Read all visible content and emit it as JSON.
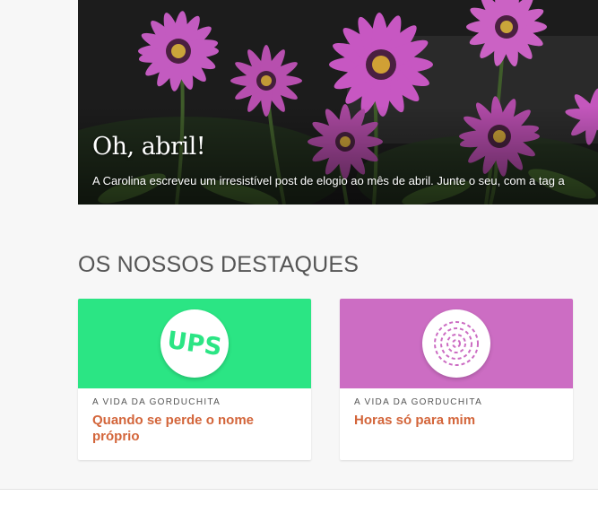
{
  "hero": {
    "title": "Oh, abril!",
    "excerpt": "A Carolina escreveu um irresistível post de elogio ao mês de abril. Junte o seu, com a tag a"
  },
  "featured": {
    "heading": "OS NOSSOS DESTAQUES",
    "cards": [
      {
        "category": "A VIDA DA GORDUCHITA",
        "title": "Quando se perde o nome próprio",
        "badge_text": "UPS",
        "color": "#2be584"
      },
      {
        "category": "A VIDA DA GORDUCHITA",
        "title": "Horas só para mim",
        "badge_icon": "spiral-icon",
        "color": "#cc6dc3"
      }
    ]
  },
  "colors": {
    "title_accent": "#d3653a",
    "background": "#f7f7f7"
  }
}
